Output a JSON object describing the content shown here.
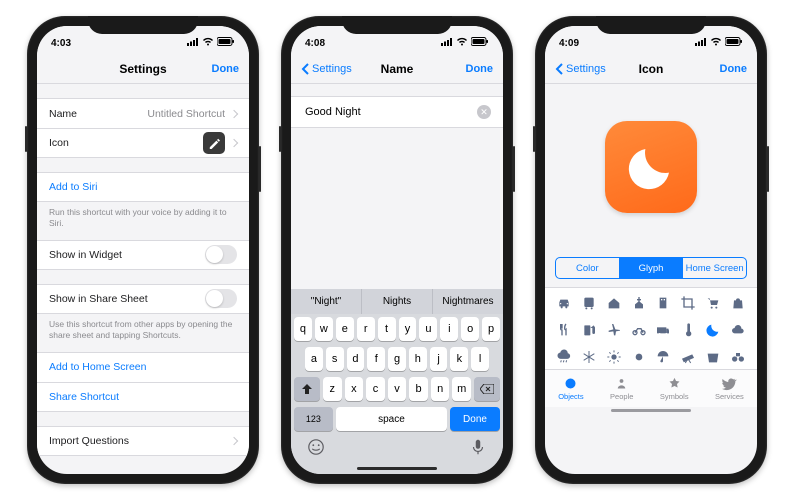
{
  "phone1": {
    "time": "4:03",
    "nav_title": "Settings",
    "done": "Done",
    "rows": {
      "name_label": "Name",
      "name_value": "Untitled Shortcut",
      "icon_label": "Icon",
      "add_siri": "Add to Siri",
      "add_siri_note": "Run this shortcut with your voice by adding it to Siri.",
      "show_widget": "Show in Widget",
      "show_share": "Show in Share Sheet",
      "share_note": "Use this shortcut from other apps by opening the share sheet and tapping Shortcuts.",
      "add_home": "Add to Home Screen",
      "share_shortcut": "Share Shortcut",
      "import_q": "Import Questions"
    }
  },
  "phone2": {
    "time": "4:08",
    "back": "Settings",
    "nav_title": "Name",
    "done": "Done",
    "input_value": "Good Night",
    "suggestions": [
      "\"Night\"",
      "Nights",
      "Nightmares"
    ],
    "rows": {
      "r1": [
        "q",
        "w",
        "e",
        "r",
        "t",
        "y",
        "u",
        "i",
        "o",
        "p"
      ],
      "r2": [
        "a",
        "s",
        "d",
        "f",
        "g",
        "h",
        "j",
        "k",
        "l"
      ],
      "r3": [
        "z",
        "x",
        "c",
        "v",
        "b",
        "n",
        "m"
      ]
    },
    "keys": {
      "num": "123",
      "space": "space",
      "done": "Done"
    }
  },
  "phone3": {
    "time": "4:09",
    "back": "Settings",
    "nav_title": "Icon",
    "done": "Done",
    "segments": [
      "Color",
      "Glyph",
      "Home Screen"
    ],
    "tabs": [
      "Objects",
      "People",
      "Symbols",
      "Services"
    ]
  }
}
